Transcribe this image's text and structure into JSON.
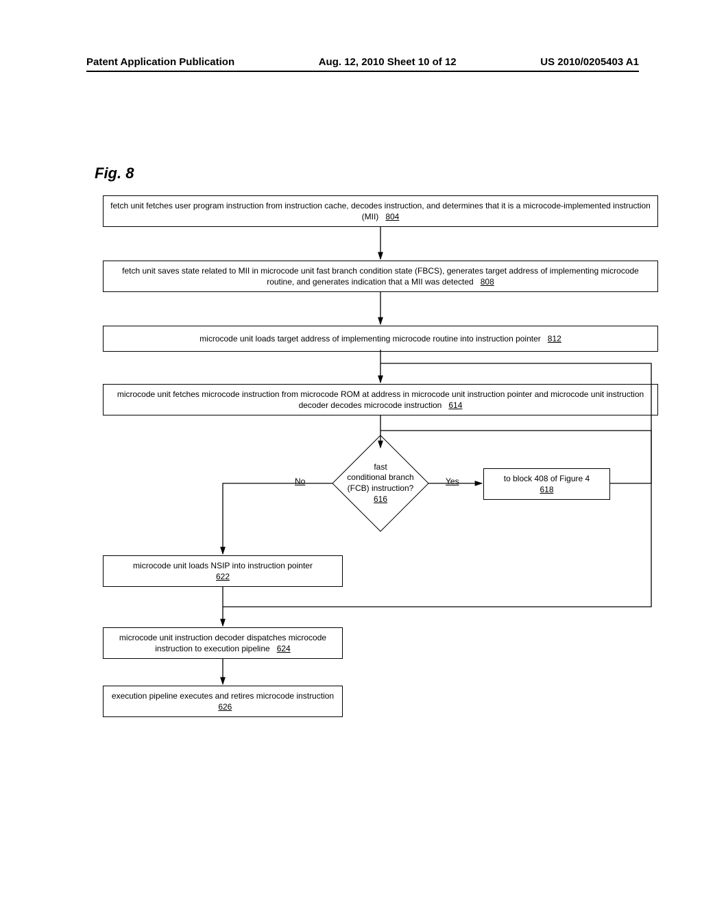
{
  "header": {
    "left": "Patent Application Publication",
    "center": "Aug. 12, 2010  Sheet 10 of 12",
    "right": "US 2010/0205403 A1"
  },
  "figure_label": "Fig. 8",
  "boxes": {
    "b804": {
      "text": "fetch unit fetches user program instruction from instruction cache, decodes instruction, and determines that it is a microcode-implemented instruction (MII)",
      "ref": "804"
    },
    "b808": {
      "text": "fetch unit saves state related to MII in microcode unit fast branch condition state (FBCS), generates target address of implementing microcode routine, and generates indication that a MII was detected",
      "ref": "808"
    },
    "b812": {
      "text": "microcode unit loads target address of implementing microcode routine into instruction pointer",
      "ref": "812"
    },
    "b614": {
      "text": "microcode unit fetches microcode instruction from microcode ROM at address in microcode unit instruction pointer and microcode unit instruction decoder decodes microcode instruction",
      "ref": "614"
    },
    "d616": {
      "text_l1": "fast",
      "text_l2": "conditional branch",
      "text_l3": "(FCB) instruction?",
      "ref": "616"
    },
    "b618": {
      "text": "to block 408 of Figure 4",
      "ref": "618"
    },
    "b622": {
      "text": "microcode unit loads NSIP into instruction pointer",
      "ref": "622"
    },
    "b624": {
      "text": "microcode unit instruction decoder dispatches microcode instruction to execution pipeline",
      "ref": "624"
    },
    "b626": {
      "text": "execution pipeline executes and retires microcode instruction",
      "ref": "626"
    }
  },
  "labels": {
    "no": "No",
    "yes": "Yes"
  }
}
